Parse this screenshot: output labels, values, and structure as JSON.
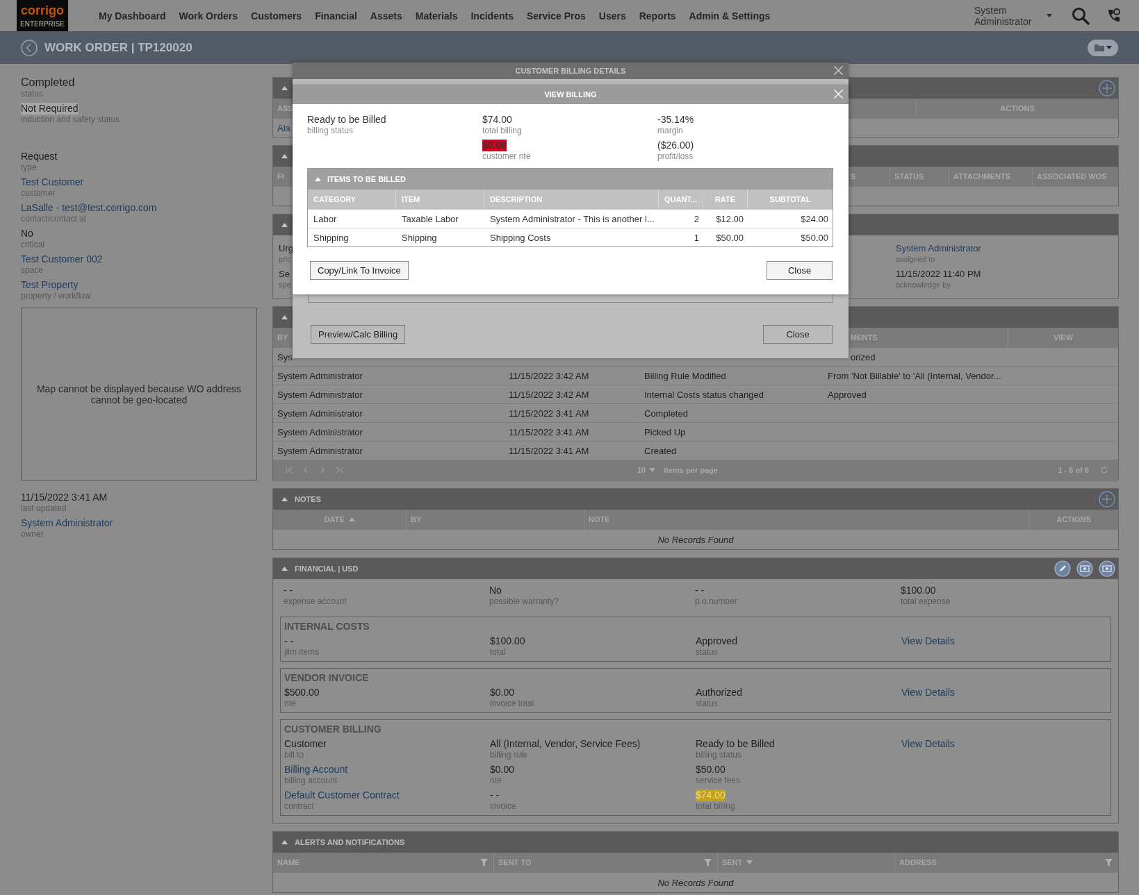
{
  "top_nav": {
    "logo": {
      "brand": "corrigo",
      "edition": "ENTERPRISE"
    },
    "menu": [
      {
        "label": "My Dashboard"
      },
      {
        "label": "Work Orders"
      },
      {
        "label": "Customers"
      },
      {
        "label": "Financial"
      },
      {
        "label": "Assets"
      },
      {
        "label": "Materials"
      },
      {
        "label": "Incidents"
      },
      {
        "label": "Service Pros"
      },
      {
        "label": "Users"
      },
      {
        "label": "Reports"
      },
      {
        "label": "Admin & Settings"
      }
    ],
    "user": "System Administrator"
  },
  "title_bar": {
    "title": "WORK ORDER | TP120020"
  },
  "summary": {
    "status_fields": [
      {
        "value": "Completed",
        "label": "status",
        "kind": "large"
      },
      {
        "value": "Not Required",
        "label": "induction and safety status",
        "kind": "gray_mark"
      }
    ],
    "detail_fields": [
      {
        "value": "Request",
        "label": "type",
        "kind": "text"
      },
      {
        "value": "Test Customer",
        "label": "customer",
        "kind": "link"
      },
      {
        "value": "LaSalle - test@test.corrigo.com",
        "label": "contact/contact at",
        "kind": "link"
      },
      {
        "value": "No",
        "label": "critical",
        "kind": "text"
      },
      {
        "value": "Test Customer 002",
        "label": "space",
        "kind": "link"
      },
      {
        "value": "Test Property",
        "label": "property / workflow",
        "kind": "link"
      }
    ],
    "map_message": "Map cannot be displayed because WO address cannot be geo-located",
    "footer_fields": [
      {
        "value": "11/15/2022 3:41 AM",
        "label": "last updated",
        "kind": "text"
      },
      {
        "value": "System Administrator",
        "label": "owner",
        "kind": "link"
      }
    ]
  },
  "assignments": {
    "expanded": true,
    "columns": [
      {
        "label": "ASS"
      },
      {
        "label": "ACTIONS"
      }
    ],
    "rows": [
      [
        "Ala"
      ]
    ]
  },
  "attachments": {
    "expanded": true,
    "columns": [
      {
        "label": "FI"
      },
      {
        "label": "S"
      },
      {
        "label": "STATUS"
      },
      {
        "label": "ATTACHMENTS"
      },
      {
        "label": "ASSOCIATED WOS"
      }
    ]
  },
  "details": {
    "expanded": true,
    "left": [
      {
        "value": "Urg",
        "label": "pric",
        "kind": "text"
      },
      {
        "value": "Se",
        "label": "spe",
        "kind": "text"
      }
    ],
    "right": [
      {
        "value": "System Administrator",
        "label": "assigned to",
        "kind": "link"
      },
      {
        "value": "11/15/2022 11:40 PM",
        "label": "acknowledge by",
        "kind": "text"
      }
    ]
  },
  "history": {
    "expanded": true,
    "columns": [
      {
        "label": "BY"
      },
      {
        "label": "MENTS"
      },
      {
        "label": "VIEW"
      }
    ],
    "partial_row": {
      "by": "Sys",
      "comments": "orized"
    },
    "rows": [
      {
        "by": "System Administrator",
        "date": "11/15/2022 3:42 AM",
        "event": "Billing Rule Modified",
        "comments": "From 'Not Billable' to 'All (Internal, Vendor..."
      },
      {
        "by": "System Administrator",
        "date": "11/15/2022 3:42 AM",
        "event": "Internal Costs status changed",
        "comments": "Approved"
      },
      {
        "by": "System Administrator",
        "date": "11/15/2022 3:41 AM",
        "event": "Completed"
      },
      {
        "by": "System Administrator",
        "date": "11/15/2022 3:41 AM",
        "event": "Picked Up"
      },
      {
        "by": "System Administrator",
        "date": "11/15/2022 3:41 AM",
        "event": "Created"
      }
    ],
    "pager": {
      "page_size": "10",
      "page_size_label": "items per page",
      "range": "1 - 6 of 6"
    }
  },
  "notes": {
    "title": "NOTES",
    "expanded": true,
    "columns": [
      {
        "label": "DATE",
        "sorted_ascending": true
      },
      {
        "label": "BY"
      },
      {
        "label": "NOTE"
      },
      {
        "label": "ACTIONS"
      }
    ],
    "empty_message": "No Records Found"
  },
  "financial": {
    "title": "FINANCIAL | USD",
    "expanded": true,
    "summary": [
      [
        {
          "value": "- -",
          "label": "expense account",
          "kind": "text"
        }
      ],
      [
        {
          "value": "No",
          "label": "possible warranty?",
          "kind": "text"
        }
      ],
      [
        {
          "value": "- -",
          "label": "p.o.number",
          "kind": "text"
        }
      ],
      [
        {
          "value": "$100.00",
          "label": "total expense",
          "kind": "text"
        }
      ]
    ],
    "sections": [
      {
        "title": "INTERNAL COSTS",
        "columns": [
          [
            {
              "value": "- -",
              "label": "jllm items",
              "kind": "text"
            }
          ],
          [
            {
              "value": "$100.00",
              "label": "total",
              "kind": "text"
            }
          ],
          [
            {
              "value": "Approved",
              "label": "status",
              "kind": "text"
            }
          ],
          [
            {
              "value": "View Details",
              "kind": "link"
            }
          ]
        ]
      },
      {
        "title": "VENDOR INVOICE",
        "columns": [
          [
            {
              "value": "$500.00",
              "label": "nte",
              "kind": "text"
            }
          ],
          [
            {
              "value": "$0.00",
              "label": "invoice total",
              "kind": "text"
            }
          ],
          [
            {
              "value": "Authorized",
              "label": "status",
              "kind": "text"
            }
          ],
          [
            {
              "value": "View Details",
              "kind": "link"
            }
          ]
        ]
      },
      {
        "title": "CUSTOMER BILLING",
        "columns": [
          [
            {
              "value": "Customer",
              "label": "bill to",
              "kind": "text"
            },
            {
              "value": "Billing Account",
              "label": "billing account",
              "kind": "link"
            },
            {
              "value": "Default Customer Contract",
              "label": "contract",
              "kind": "link"
            }
          ],
          [
            {
              "value": "All (Internal, Vendor, Service Fees)",
              "label": "billing rule",
              "kind": "text"
            },
            {
              "value": "$0.00",
              "label": "nte",
              "kind": "text"
            },
            {
              "value": "- -",
              "label": "invoice",
              "kind": "text"
            }
          ],
          [
            {
              "value": "Ready to be Billed",
              "label": "billing status",
              "kind": "text"
            },
            {
              "value": "$50.00",
              "label": "service fees",
              "kind": "text"
            },
            {
              "value": "$74.00",
              "label": "total billing",
              "kind": "gold_mark"
            }
          ],
          [
            {
              "value": "View Details",
              "kind": "link"
            }
          ]
        ]
      }
    ]
  },
  "alerts": {
    "title": "ALERTS AND NOTIFICATIONS",
    "expanded": true,
    "columns": [
      {
        "label": "NAME",
        "filter": true
      },
      {
        "label": "SENT TO",
        "filter": true
      },
      {
        "label": "SENT",
        "sorted_descending": true
      },
      {
        "label": "ADDRESS",
        "filter": true
      }
    ],
    "empty_message": "No Records Found"
  },
  "billing_details_dialog": {
    "title": "CUSTOMER BILLING DETAILS",
    "buttons": [
      {
        "label": "Preview/Calc Billing"
      },
      {
        "label": "Close"
      }
    ]
  },
  "view_billing_dialog": {
    "title": "VIEW BILLING",
    "columns": [
      [
        {
          "value": "Ready to be Billed",
          "label": "billing status",
          "kind": "text"
        }
      ],
      [
        {
          "value": "$74.00",
          "label": "total billing",
          "kind": "text"
        },
        {
          "value": "$0.00",
          "label": "customer nte",
          "kind": "red_mark"
        }
      ],
      [
        {
          "value": "-35.14%",
          "label": "margin",
          "kind": "text"
        },
        {
          "value": "($26.00)",
          "label": "profit/loss",
          "kind": "text"
        }
      ]
    ],
    "items": {
      "title": "ITEMS TO BE BILLED",
      "expanded": true,
      "columns": [
        {
          "label": "CATEGORY"
        },
        {
          "label": "ITEM"
        },
        {
          "label": "DESCRIPTION"
        },
        {
          "label": "QUANT..."
        },
        {
          "label": "RATE"
        },
        {
          "label": "SUBTOTAL"
        }
      ],
      "rows": [
        [
          "Labor",
          "Taxable Labor",
          "System Administrator - This is another l...",
          "2",
          "$12.00",
          "$24.00"
        ],
        [
          "Shipping",
          "Shipping",
          "Shipping Costs",
          "1",
          "$50.00",
          "$50.00"
        ]
      ]
    },
    "buttons": [
      {
        "label": "Copy/Link To Invoice"
      },
      {
        "label": "Close"
      }
    ]
  }
}
